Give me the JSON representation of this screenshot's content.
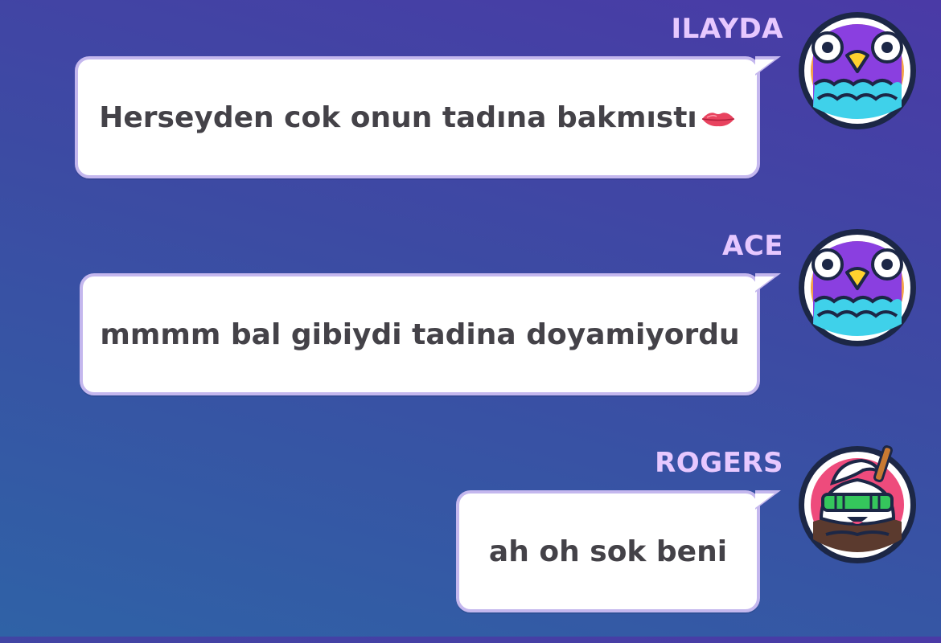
{
  "messages": [
    {
      "sender": "ILAYDA",
      "text": "Herseyden cok onun tadına bakmıstı",
      "emoji": "lips-emoji",
      "avatar": "purple-bird-avatar"
    },
    {
      "sender": "ACE",
      "text": "mmmm bal gibiydi tadina doyamiyordu",
      "avatar": "purple-bird-avatar"
    },
    {
      "sender": "ROGERS",
      "text": "ah oh sok beni",
      "avatar": "ice-cream-sunglasses-avatar"
    }
  ],
  "colors": {
    "sender_name": "#e7c8ff",
    "bubble_border": "#c4b7ee",
    "bubble_text": "#444248",
    "background_top": "#4a3aa6",
    "background_bottom": "#2f62a6"
  }
}
